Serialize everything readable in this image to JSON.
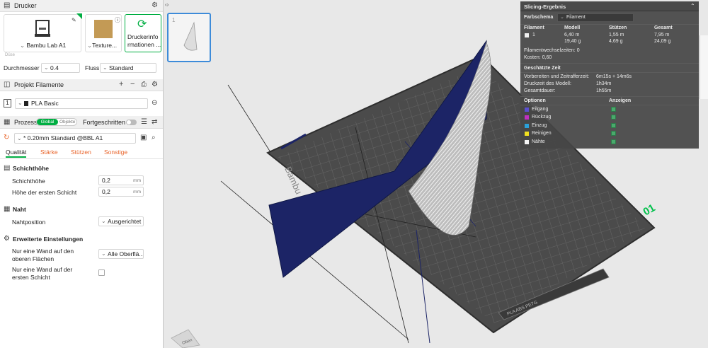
{
  "printer_section": {
    "title": "Drucker",
    "printer_name": "Bambu Lab A1",
    "plate_name": "Texture...",
    "info_line1": "Druckerinfo",
    "info_line2": "rmationen ...",
    "small_label": "Düse"
  },
  "nozzle": {
    "diameter_label": "Durchmesser",
    "diameter_value": "0.4",
    "flow_label": "Fluss",
    "flow_value": "Standard"
  },
  "filament_section": {
    "title": "Projekt Filamente",
    "slot": "1",
    "filament": "PLA Basic"
  },
  "process": {
    "title": "Prozess",
    "global": "Global",
    "objects": "Objekte",
    "advanced": "Fortgeschritten",
    "preset": "* 0.20mm Standard @BBL A1"
  },
  "tabs": [
    "Qualität",
    "Stärke",
    "Stützen",
    "Sonstige"
  ],
  "layer_height": {
    "title": "Schichthöhe",
    "layer_label": "Schichthöhe",
    "layer_value": "0,2",
    "first_label": "Höhe der ersten Schicht",
    "first_value": "0,2",
    "unit": "mm"
  },
  "seam": {
    "title": "Naht",
    "pos_label": "Nahtposition",
    "pos_value": "Ausgerichtet"
  },
  "advanced": {
    "title": "Erweiterte Einstellungen",
    "wall_top_l1": "Nur eine Wand auf den",
    "wall_top_l2": "oberen Flächen",
    "wall_top_value": "Alle Oberflä...",
    "wall_first_l1": "Nur eine Wand auf der",
    "wall_first_l2": "ersten Schicht"
  },
  "thumb_label": "1",
  "plate": {
    "brand": "Bambu",
    "number": "01",
    "material": "PLA ABS PETG"
  },
  "nav_cube": "Oben",
  "slicing": {
    "title": "Slicing-Ergebnis",
    "scheme_label": "Farbschema",
    "scheme_value": "Filament",
    "col_filament": "Filament",
    "col_model": "Modell",
    "col_supports": "Stützen",
    "col_total": "Gesamt",
    "row_id": "1",
    "model_m": "6,40 m",
    "model_g": "19,40 g",
    "supp_m": "1,55 m",
    "supp_g": "4,69 g",
    "total_m": "7,95 m",
    "total_g": "24,09 g",
    "changes_label": "Filamentwechselzeiten:",
    "changes_value": "0",
    "cost_label": "Kosten:",
    "cost_value": "0,60",
    "time_title": "Geschätzte Zeit",
    "prep_label": "Vorbereiten und Zeitrafferzeit:",
    "prep_value": "6m15s + 14m6s",
    "model_time_label": "Druckzeit des Modell:",
    "model_time_value": "1h34m",
    "total_time_label": "Gesamtdauer:",
    "total_time_value": "1h55m",
    "options_label": "Optionen",
    "show_label": "Anzeigen",
    "options": [
      {
        "name": "Eilgang",
        "color": "#5a4fcf"
      },
      {
        "name": "Rückzug",
        "color": "#c02fc0"
      },
      {
        "name": "Einzug",
        "color": "#2aa0d8"
      },
      {
        "name": "Reinigen",
        "color": "#f0e020"
      },
      {
        "name": "Nähte",
        "color": "#f4f4f4"
      }
    ]
  },
  "colors": {
    "accent": "#00ae42",
    "tab": "#e8642a",
    "model_blue": "#1c2466",
    "bed": "#4b4b4b"
  }
}
